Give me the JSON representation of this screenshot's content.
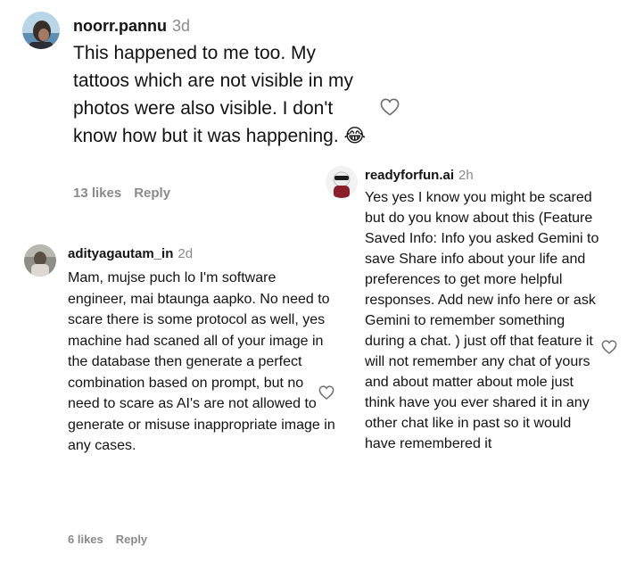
{
  "comments": [
    {
      "username": "noorr.pannu",
      "time": "3d",
      "text": "This happened to me too. My tattoos which are not visible in my photos were also visible. I don't know how but it was happening. 😂",
      "likes": "13 likes",
      "reply": "Reply",
      "avatar_icon": "avatar-photo-icon"
    },
    {
      "username": "adityagautam_in",
      "time": "2d",
      "text": "Mam, mujse puch lo I'm software engineer, mai btaunga aapko. No need to scare there is some protocol as well, yes machine had scaned all of your image in the database then generate a perfect combination based on prompt, but no need to scare as AI's are not allowed to generate or misuse inappropriate image in any cases.",
      "likes": "6 likes",
      "reply": "Reply",
      "avatar_icon": "avatar-photo-icon"
    },
    {
      "username": "readyforfun.ai",
      "time": "2h",
      "text": "Yes yes I know you might be scared but do you know about this (Feature Saved Info: Info you asked Gemini to save Share info about your life and preferences to get more helpful responses. Add new info here or ask Gemini to remember something during a chat. ) just off that feature it will not remember any chat of yours and about matter about mole just think have you ever shared it in any other chat like in past so it would have remembered it",
      "avatar_icon": "avatar-photo-icon"
    }
  ],
  "colors": {
    "text": "#121212",
    "muted": "#8a8a8a",
    "heart_stroke": "#6e6e6e"
  }
}
